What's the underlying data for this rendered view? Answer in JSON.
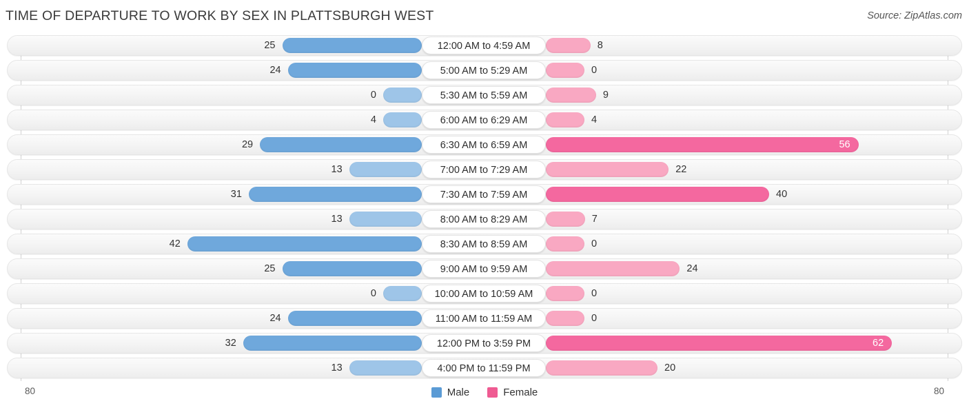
{
  "header": {
    "title": "TIME OF DEPARTURE TO WORK BY SEX IN PLATTSBURGH WEST",
    "source": "Source: ZipAtlas.com"
  },
  "legend": {
    "male_label": "Male",
    "female_label": "Female",
    "male_color": "#5b9bd5",
    "female_color": "#ef5b92"
  },
  "axis": {
    "left_tick": "80",
    "right_tick": "80"
  },
  "chart_data": {
    "type": "bar",
    "title": "TIME OF DEPARTURE TO WORK BY SEX IN PLATTSBURGH WEST",
    "subtitle": "Source: ZipAtlas.com",
    "orientation": "horizontal-diverging",
    "xlabel": "",
    "ylabel": "",
    "xlim": [
      80,
      80
    ],
    "axis_ticks": [
      "80",
      "80"
    ],
    "grid": false,
    "legend_position": "bottom-center",
    "categories": [
      "12:00 AM to 4:59 AM",
      "5:00 AM to 5:29 AM",
      "5:30 AM to 5:59 AM",
      "6:00 AM to 6:29 AM",
      "6:30 AM to 6:59 AM",
      "7:00 AM to 7:29 AM",
      "7:30 AM to 7:59 AM",
      "8:00 AM to 8:29 AM",
      "8:30 AM to 8:59 AM",
      "9:00 AM to 9:59 AM",
      "10:00 AM to 10:59 AM",
      "11:00 AM to 11:59 AM",
      "12:00 PM to 3:59 PM",
      "4:00 PM to 11:59 PM"
    ],
    "series": [
      {
        "name": "Male",
        "color": "#6fa8dc",
        "values": [
          25,
          24,
          0,
          4,
          29,
          13,
          31,
          13,
          42,
          25,
          0,
          24,
          32,
          13
        ]
      },
      {
        "name": "Female",
        "color": "#f4689f",
        "values": [
          8,
          0,
          9,
          4,
          56,
          22,
          40,
          7,
          0,
          24,
          0,
          0,
          62,
          20
        ]
      }
    ]
  },
  "rows": [
    {
      "label": "12:00 AM to 4:59 AM",
      "male": "25",
      "female": "8"
    },
    {
      "label": "5:00 AM to 5:29 AM",
      "male": "24",
      "female": "0"
    },
    {
      "label": "5:30 AM to 5:59 AM",
      "male": "0",
      "female": "9"
    },
    {
      "label": "6:00 AM to 6:29 AM",
      "male": "4",
      "female": "4"
    },
    {
      "label": "6:30 AM to 6:59 AM",
      "male": "29",
      "female": "56"
    },
    {
      "label": "7:00 AM to 7:29 AM",
      "male": "13",
      "female": "22"
    },
    {
      "label": "7:30 AM to 7:59 AM",
      "male": "31",
      "female": "40"
    },
    {
      "label": "8:00 AM to 8:29 AM",
      "male": "13",
      "female": "7"
    },
    {
      "label": "8:30 AM to 8:59 AM",
      "male": "42",
      "female": "0"
    },
    {
      "label": "9:00 AM to 9:59 AM",
      "male": "25",
      "female": "24"
    },
    {
      "label": "10:00 AM to 10:59 AM",
      "male": "0",
      "female": "0"
    },
    {
      "label": "11:00 AM to 11:59 AM",
      "male": "24",
      "female": "0"
    },
    {
      "label": "12:00 PM to 3:59 PM",
      "male": "32",
      "female": "62"
    },
    {
      "label": "4:00 PM to 11:59 PM",
      "male": "13",
      "female": "20"
    }
  ]
}
